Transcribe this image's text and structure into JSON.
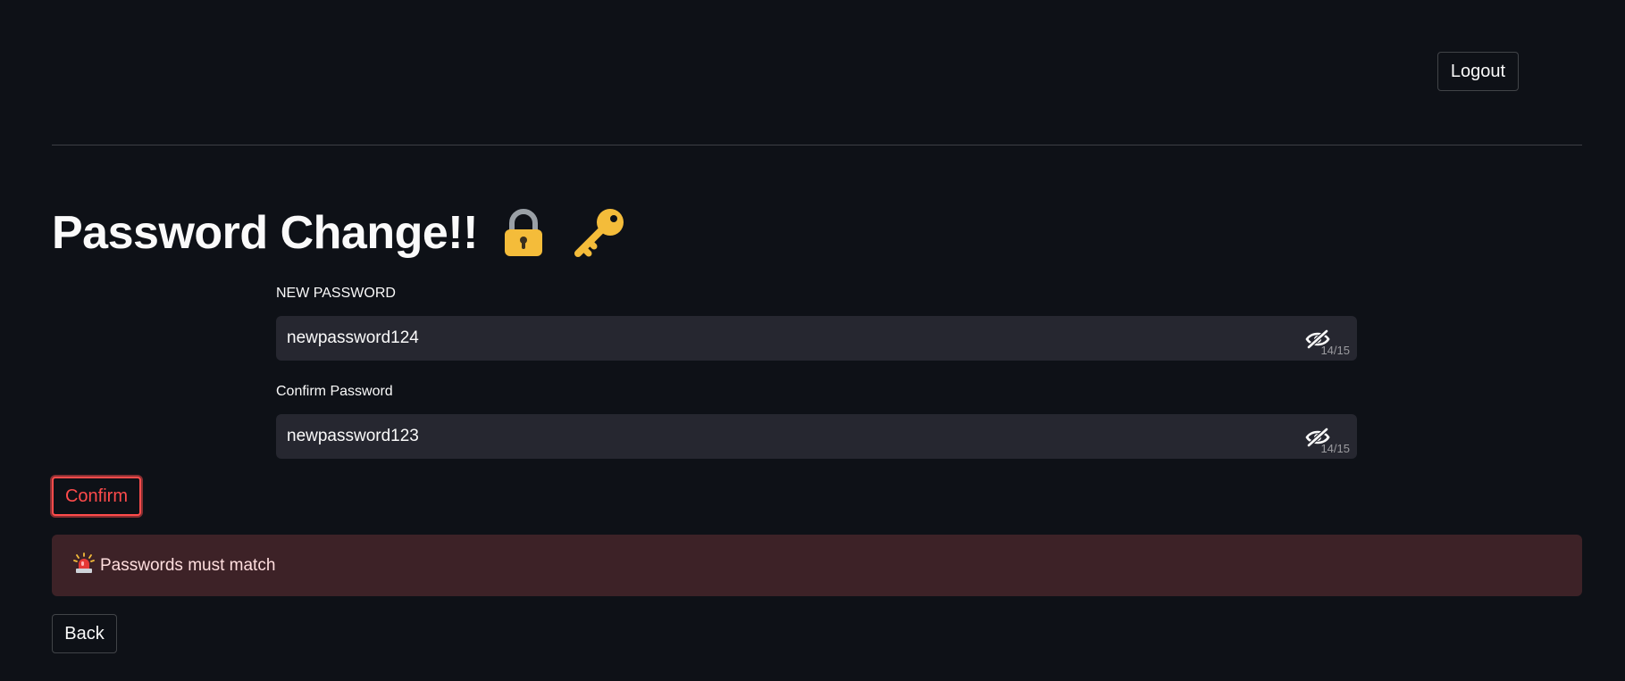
{
  "header": {
    "logout_label": "Logout"
  },
  "page": {
    "title": "Password Change!!",
    "title_icons": [
      "lock-icon",
      "key-icon"
    ]
  },
  "form": {
    "new_password": {
      "label": "NEW PASSWORD",
      "value": "newpassword124",
      "counter": "14/15",
      "toggle_icon": "eye-slash-icon"
    },
    "confirm_password": {
      "label": "Confirm Password",
      "value": "newpassword123",
      "counter": "14/15",
      "toggle_icon": "eye-slash-icon"
    },
    "confirm_label": "Confirm"
  },
  "alert": {
    "icon": "rotating-light-icon",
    "message": "Passwords must match"
  },
  "footer": {
    "back_label": "Back"
  },
  "colors": {
    "background": "#0e1117",
    "input_background": "#262730",
    "accent_red": "#ff4b4b",
    "alert_background": "#3d2227",
    "icon_gold": "#f4bc3a"
  }
}
